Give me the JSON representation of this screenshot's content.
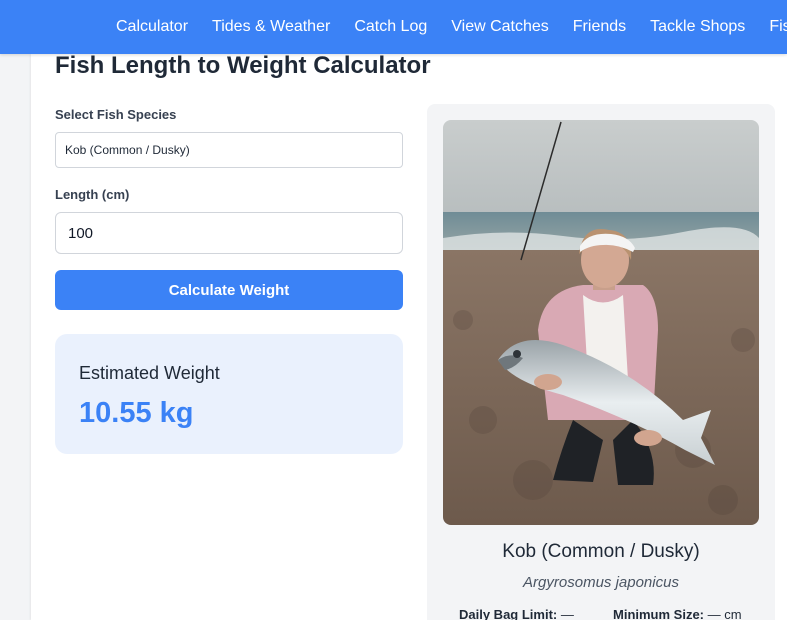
{
  "nav": {
    "items": [
      {
        "label": "Calculator"
      },
      {
        "label": "Tides & Weather"
      },
      {
        "label": "Catch Log"
      },
      {
        "label": "View Catches"
      },
      {
        "label": "Friends"
      },
      {
        "label": "Tackle Shops"
      },
      {
        "label": "Fishing"
      }
    ]
  },
  "page": {
    "title": "Fish Length to Weight Calculator"
  },
  "form": {
    "species_label": "Select Fish Species",
    "species_value": "Kob (Common / Dusky)",
    "length_label": "Length (cm)",
    "length_value": "100",
    "calculate_button": "Calculate Weight"
  },
  "result": {
    "label": "Estimated Weight",
    "value": "10.55 kg"
  },
  "species_card": {
    "photo_icon": "fish-photo",
    "name": "Kob (Common / Dusky)",
    "scientific_name": "Argyrosomus japonicus",
    "bag_limit_label": "Daily Bag Limit:",
    "bag_limit_value": "—",
    "min_size_label": "Minimum Size:",
    "min_size_value": "— cm"
  },
  "colors": {
    "accent": "#3b82f6",
    "result_bg": "#eaf1fd",
    "card_bg": "#f3f4f6"
  }
}
